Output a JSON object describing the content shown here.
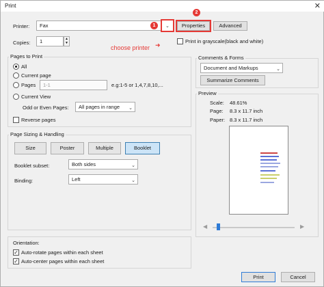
{
  "window": {
    "title": "Print"
  },
  "printer": {
    "label": "Printer:",
    "value": "Fax",
    "properties_label": "Properties",
    "advanced_label": "Advanced",
    "copies_label": "Copies:",
    "copies_value": "1",
    "grayscale_label": "Print in grayscale(black and white)"
  },
  "annotations": {
    "badge1": "1",
    "badge2": "2",
    "choose_printer": "choose printer"
  },
  "pages_to_print": {
    "title": "Pages to Print",
    "all_label": "All",
    "current_page_label": "Current page",
    "pages_label": "Pages",
    "pages_placeholder": "1-1",
    "pages_hint": "e.g:1-5 or 1,4,7,8,10,...",
    "current_view_label": "Current View",
    "odd_even_label": "Odd or Even Pages:",
    "odd_even_value": "All pages in range",
    "reverse_label": "Reverse pages"
  },
  "sizing": {
    "title": "Page Sizing & Handling",
    "tabs": [
      "Size",
      "Poster",
      "Multiple",
      "Booklet"
    ],
    "subset_label": "Booklet subset:",
    "subset_value": "Both sides",
    "binding_label": "Binding:",
    "binding_value": "Left"
  },
  "orientation": {
    "title": "Orientation:",
    "auto_rotate": "Auto-rotate pages within each sheet",
    "auto_center": "Auto-center pages within each sheet"
  },
  "comments": {
    "title": "Comments & Forms",
    "value": "Document and Markups",
    "summarize_label": "Summarize Comments"
  },
  "preview": {
    "title": "Preview",
    "scale_label": "Scale:",
    "scale_value": "48.61%",
    "page_label": "Page:",
    "page_value": "8.3 x 11.7 inch",
    "paper_label": "Paper:",
    "paper_value": "8.3 x 11.7 inch"
  },
  "footer": {
    "print_label": "Print",
    "cancel_label": "Cancel"
  }
}
